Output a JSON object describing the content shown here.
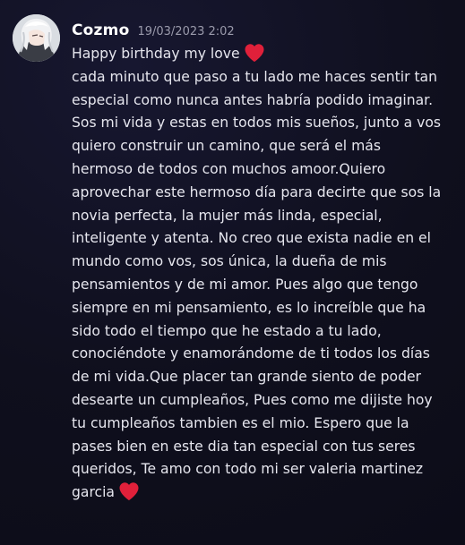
{
  "message": {
    "author": "Cozmo",
    "timestamp": "19/03/2023 2:02",
    "avatar_icon": "anime-avatar-icon",
    "heart_icon": "red-heart-emoji-icon",
    "heart_color": "#e0203a",
    "lines": [
      "Happy birthday my love",
      "cada minuto que paso a tu lado me haces sentir tan",
      "especial como nunca antes habría podido imaginar.",
      "Sos mi vida y estas en todos mis sueños, junto a vos",
      "quiero construir un camino, que será el más",
      "hermoso de todos con muchos amoor.Quiero",
      "aprovechar este hermoso día para decirte que sos la",
      "novia perfecta, la mujer más linda, especial,",
      "inteligente y atenta. No creo que exista nadie en el",
      "mundo como vos, sos única, la dueña de mis",
      "pensamientos y de mi amor. Pues algo que tengo",
      "siempre en mi pensamiento, es lo increíble que ha",
      "sido todo el tiempo que he estado a tu lado,",
      "conociéndote y enamorándome de ti todos los días",
      "de mi vida.Que placer tan grande siento de poder",
      "desearte un cumpleaños, Pues como me dijiste hoy",
      "tu cumpleaños tambien es el mio. Espero que la",
      "pases bien en este dia tan especial con tus seres",
      "queridos,  Te amo con todo mi ser valeria martinez",
      "garcia"
    ]
  }
}
